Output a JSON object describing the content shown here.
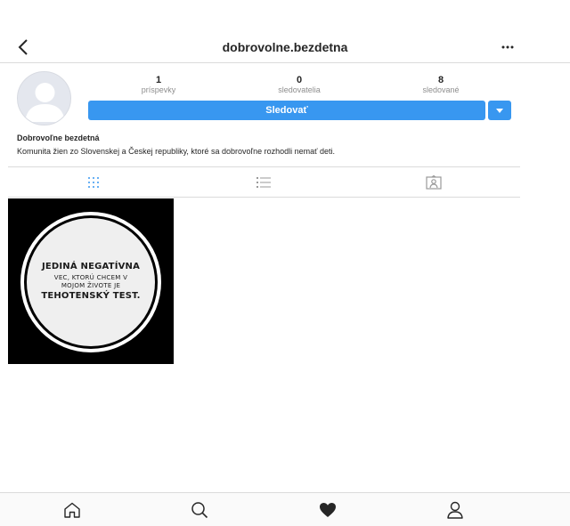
{
  "header": {
    "username": "dobrovolne.bezdetna",
    "back_icon": "chevron-left-icon",
    "more_icon": "more-horizontal-icon"
  },
  "profile": {
    "avatar_icon": "default-avatar-icon",
    "stats": {
      "posts": {
        "count": "1",
        "label": "príspevky"
      },
      "followers": {
        "count": "0",
        "label": "sledovatelia"
      },
      "following": {
        "count": "8",
        "label": "sledované"
      }
    },
    "follow_label": "Sledovať",
    "dropdown_icon": "caret-down-icon",
    "name": "Dobrovoľne bezdetná",
    "bio": "Komunita žien zo Slovenskej a Českej republiky, ktoré sa dobrovoľne rozhodli nemať deti."
  },
  "tabs": [
    {
      "icon": "grid-icon",
      "active": true
    },
    {
      "icon": "list-icon",
      "active": false
    },
    {
      "icon": "tagged-icon",
      "active": false
    }
  ],
  "post": {
    "line1": "JEDINÁ NEGATÍVNA",
    "line2": "VEC, KTORÚ CHCEM V",
    "line3": "MOJOM ŽIVOTE JE",
    "line4": "TEHOTENSKÝ TEST."
  },
  "bottom_nav": [
    "home-icon",
    "search-icon",
    "heart-icon",
    "profile-icon"
  ],
  "colors": {
    "accent": "#3897f0",
    "text": "#262626",
    "muted": "#8e8e8e",
    "border": "#dbdbdb"
  }
}
